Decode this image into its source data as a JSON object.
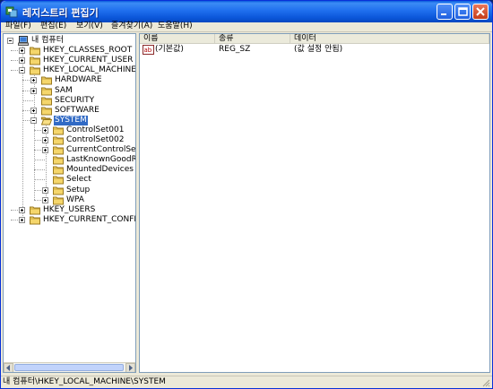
{
  "window": {
    "title": "레지스트리 편집기"
  },
  "menu": [
    {
      "name": "menu-file",
      "label": "파일(F)"
    },
    {
      "name": "menu-edit",
      "label": "편집(E)"
    },
    {
      "name": "menu-view",
      "label": "보기(V)"
    },
    {
      "name": "menu-favorites",
      "label": "즐겨찾기(A)"
    },
    {
      "name": "menu-help",
      "label": "도움말(H)"
    }
  ],
  "tree": [
    {
      "label": "내 컴퓨터",
      "icon": "computer-icon",
      "expander": "minus"
    },
    {
      "label": "HKEY_CLASSES_ROOT",
      "icon": "folder-icon",
      "expander": "plus"
    },
    {
      "label": "HKEY_CURRENT_USER",
      "icon": "folder-icon",
      "expander": "plus"
    },
    {
      "label": "HKEY_LOCAL_MACHINE",
      "icon": "folder-icon",
      "expander": "minus"
    },
    {
      "label": "HARDWARE",
      "icon": "folder-icon",
      "expander": "plus"
    },
    {
      "label": "SAM",
      "icon": "folder-icon",
      "expander": "plus"
    },
    {
      "label": "SECURITY",
      "icon": "folder-icon",
      "expander": "none"
    },
    {
      "label": "SOFTWARE",
      "icon": "folder-icon",
      "expander": "plus"
    },
    {
      "label": "SYSTEM",
      "icon": "open-folder-icon",
      "expander": "minus",
      "selected": true
    },
    {
      "label": "ControlSet001",
      "icon": "folder-icon",
      "expander": "plus"
    },
    {
      "label": "ControlSet002",
      "icon": "folder-icon",
      "expander": "plus"
    },
    {
      "label": "CurrentControlSet",
      "icon": "folder-icon",
      "expander": "plus"
    },
    {
      "label": "LastKnownGoodRec",
      "icon": "folder-icon",
      "expander": "none"
    },
    {
      "label": "MountedDevices",
      "icon": "folder-icon",
      "expander": "none"
    },
    {
      "label": "Select",
      "icon": "folder-icon",
      "expander": "none"
    },
    {
      "label": "Setup",
      "icon": "folder-icon",
      "expander": "plus"
    },
    {
      "label": "WPA",
      "icon": "folder-icon",
      "expander": "plus"
    },
    {
      "label": "HKEY_USERS",
      "icon": "folder-icon",
      "expander": "plus"
    },
    {
      "label": "HKEY_CURRENT_CONFIG",
      "icon": "folder-icon",
      "expander": "plus"
    }
  ],
  "list": {
    "headers": {
      "name": "이름",
      "type": "종류",
      "data": "데이터"
    },
    "rows": [
      {
        "icon": "string-value-icon",
        "name": "(기본값)",
        "type": "REG_SZ",
        "data": "(값 설정 안됨)"
      }
    ]
  },
  "status": {
    "path": "내 컴퓨터\\HKEY_LOCAL_MACHINE\\SYSTEM"
  },
  "colors": {
    "titlebar": "#1f6fee",
    "selection": "#316ac5",
    "folder": "#f5d66b"
  }
}
